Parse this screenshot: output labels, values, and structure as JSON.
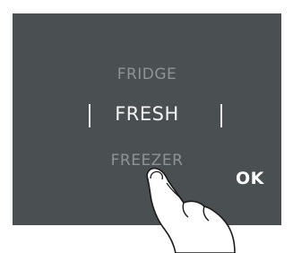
{
  "selector": {
    "previous_option": "FRIDGE",
    "selected_option": "FRESH",
    "next_option": "FREEZER"
  },
  "ok_button": {
    "label": "OK"
  },
  "colors": {
    "panel_background": "#4a4f51",
    "selected_text": "#f4f4f4",
    "dim_text": "#8e9396"
  },
  "icons": {
    "hand": "pointing-finger-icon"
  }
}
